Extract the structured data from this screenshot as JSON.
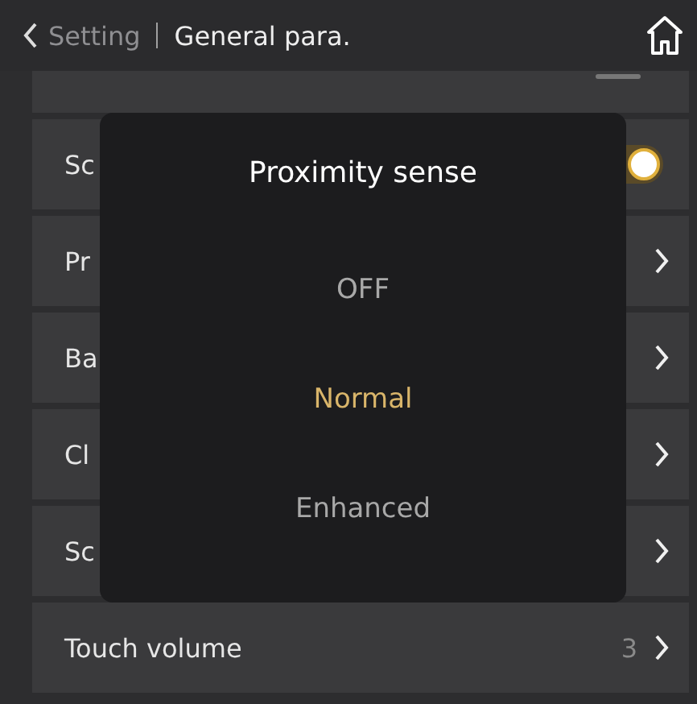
{
  "header": {
    "back_label": "Setting",
    "title": "General para."
  },
  "rows": [
    {
      "kind": "toggle",
      "label": "Sc",
      "on": true
    },
    {
      "kind": "link",
      "label": "Pr"
    },
    {
      "kind": "link",
      "label": "Ba"
    },
    {
      "kind": "link",
      "label": "Cl"
    },
    {
      "kind": "link",
      "label": "Sc"
    },
    {
      "kind": "link",
      "label": "Touch volume",
      "value": "3"
    }
  ],
  "dialog": {
    "title": "Proximity sense",
    "options": [
      {
        "label": "OFF",
        "selected": false
      },
      {
        "label": "Normal",
        "selected": true
      },
      {
        "label": "Enhanced",
        "selected": false
      }
    ]
  }
}
